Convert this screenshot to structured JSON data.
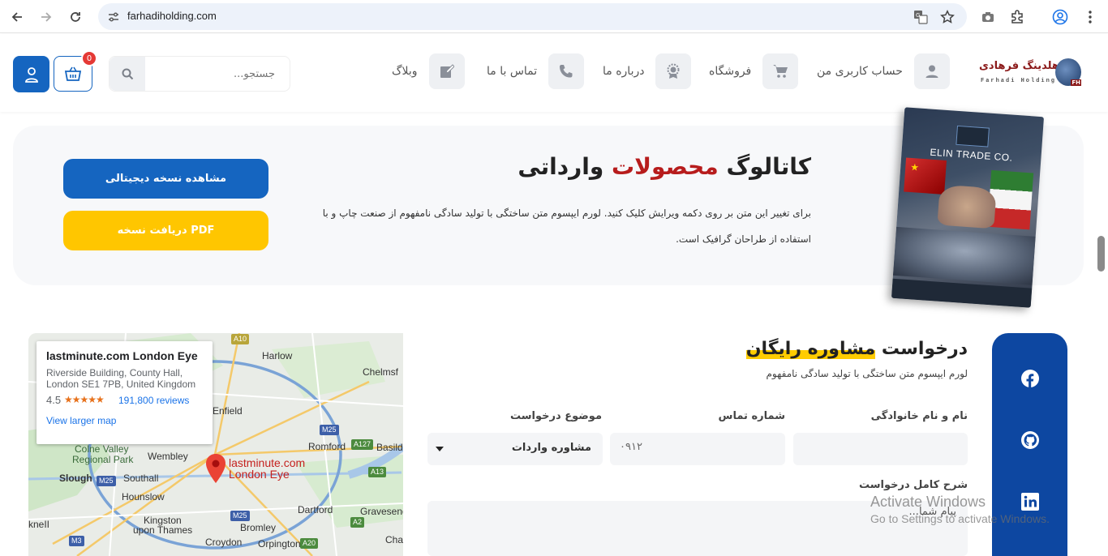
{
  "browser": {
    "url": "farhadiholding.com"
  },
  "header": {
    "logo_text": "هلدینگ فرهادی",
    "logo_sub": "Farhadi Holding",
    "logo_badge": "FH",
    "menu": [
      {
        "label": "حساب کاربری من",
        "icon": "user-icon"
      },
      {
        "label": "فروشگاه",
        "icon": "cart-icon"
      },
      {
        "label": "درباره ما",
        "icon": "badge-icon"
      },
      {
        "label": "تماس با ما",
        "icon": "phone-icon"
      },
      {
        "label": "وبلاگ",
        "icon": "edit-icon"
      }
    ],
    "search_placeholder": "جستجو...",
    "cart_count": "0"
  },
  "catalog": {
    "title_part1": "کاتالوگ",
    "title_highlight": "محصولات",
    "title_part2": "وارداتی",
    "description": "برای تغییر این متن بر روی دکمه ویرایش کلیک کنید. لورم ایپسوم متن ساختگی با تولید سادگی نامفهوم از صنعت چاپ و با استفاده از طراحان گرافیک است.",
    "btn_digital": "مشاهده نسخه دیجیتالی",
    "btn_pdf": "دریافت نسخه PDF",
    "book_brand": "ELIN TRADE CO."
  },
  "map": {
    "place_name": "lastminute.com London Eye",
    "address_line1": "Riverside Building, County Hall,",
    "address_line2": "London SE1 7PB, United Kingdom",
    "rating": "4.5",
    "stars": "★★★★★",
    "reviews": "191,800 reviews",
    "view_larger": "View larger map",
    "pin_label_1": "lastminute.com",
    "pin_label_2": "London Eye",
    "places": [
      "Harlow",
      "Chelmsf",
      "Enfield",
      "Romford",
      "Basild",
      "Wembley",
      "Colne Valley",
      "Regional Park",
      "Slough",
      "Southall",
      "Hounslow",
      "Kingston",
      "upon Thames",
      "Dartford",
      "Gravesend",
      "Bromley",
      "Croydon",
      "Orpington",
      "Cha",
      "kneII"
    ],
    "roads": [
      "A10",
      "M25",
      "A127",
      "A13",
      "M25",
      "A2",
      "M3",
      "M25",
      "A20"
    ]
  },
  "form": {
    "title_part1": "درخواست",
    "title_highlight": "مشاوره رایگان",
    "subtitle": "لورم ایپسوم متن ساختگی با تولید سادگی نامفهوم",
    "label_name": "نام و نام خانوادگی",
    "label_phone": "شماره تماس",
    "label_subject": "موضوع درخواست",
    "phone_placeholder": "۰۹۱۲",
    "subject_value": "مشاوره واردات",
    "label_details": "شرح کامل درخواست",
    "details_placeholder": "پیام شما..."
  },
  "social": [
    "facebook-icon",
    "github-icon",
    "linkedin-icon"
  ],
  "watermark": {
    "line1": "Activate Windows",
    "line2": "Go to Settings to activate Windows."
  }
}
